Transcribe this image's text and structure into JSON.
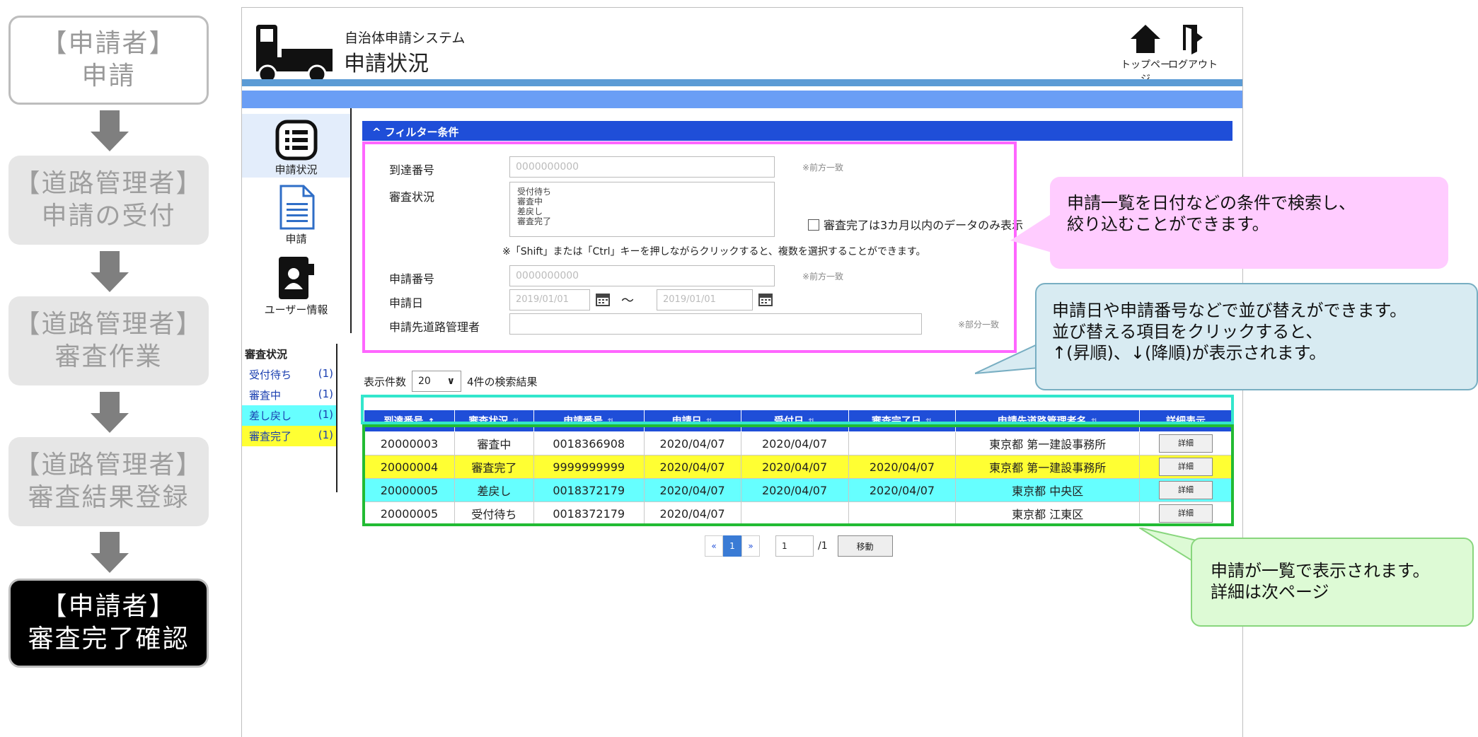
{
  "flow": {
    "step1_line1": "【申請者】",
    "step1_line2": "申請",
    "step2_line1": "【道路管理者】",
    "step2_line2": "申請の受付",
    "step3_line1": "【道路管理者】",
    "step3_line2": "審査作業",
    "step4_line1": "【道路管理者】",
    "step4_line2": "審査結果登録",
    "step5_line1": "【申請者】",
    "step5_line2": "審査完了確認"
  },
  "header": {
    "system_name": "自治体申請システム",
    "page_title": "申請状況",
    "top_page_label": "トップページ",
    "logout_label": "ログアウト"
  },
  "nav": {
    "status_label": "申請状況",
    "apply_label": "申請",
    "user_info_label": "ユーザー情報"
  },
  "status_panel": {
    "title": "審査状況",
    "items": [
      {
        "label": "受付待ち",
        "count": "(1)"
      },
      {
        "label": "審査中",
        "count": "(1)"
      },
      {
        "label": "差し戻し",
        "count": "(1)"
      },
      {
        "label": "審査完了",
        "count": "(1)"
      }
    ]
  },
  "filter": {
    "heading": "^ フィルター条件",
    "arrival_no_label": "到達番号",
    "arrival_no_placeholder": "0000000000",
    "prefix_note": "※前方一致",
    "review_status_label": "審査状況",
    "status_options": [
      "受付待ち",
      "審査中",
      "差戻し",
      "審査完了"
    ],
    "recent_only_label": "審査完了は3カ月以内のデータのみ表示",
    "multi_select_note": "※「Shift」または「Ctrl」キーを押しながらクリックすると、複数を選択することができます。",
    "application_no_label": "申請番号",
    "application_no_placeholder": "0000000000",
    "application_date_label": "申請日",
    "date_from": "2019/01/01",
    "date_to": "2019/01/01",
    "tilde": "～",
    "manager_label": "申請先道路管理者",
    "partial_note": "※部分一致"
  },
  "results": {
    "page_size_label": "表示件数",
    "page_size": "20",
    "count_text": "4件の検索結果",
    "columns": [
      "到達番号",
      "審査状況",
      "申請番号",
      "申請日",
      "受付日",
      "審査完了日",
      "申請先道路管理者名",
      "詳細表示"
    ],
    "sort_up": "↑",
    "sort_both": "⇅",
    "rows": [
      {
        "arrival": "20000003",
        "status": "審査中",
        "app_no": "0018366908",
        "app_date": "2020/04/07",
        "recv_date": "2020/04/07",
        "done_date": "",
        "manager": "東京都 第一建設事務所",
        "detail": "詳細"
      },
      {
        "arrival": "20000004",
        "status": "審査完了",
        "app_no": "9999999999",
        "app_date": "2020/04/07",
        "recv_date": "2020/04/07",
        "done_date": "2020/04/07",
        "manager": "東京都 第一建設事務所",
        "detail": "詳細"
      },
      {
        "arrival": "20000005",
        "status": "差戻し",
        "app_no": "0018372179",
        "app_date": "2020/04/07",
        "recv_date": "2020/04/07",
        "done_date": "2020/04/07",
        "manager": "東京都 中央区",
        "detail": "詳細"
      },
      {
        "arrival": "20000005",
        "status": "受付待ち",
        "app_no": "0018372179",
        "app_date": "2020/04/07",
        "recv_date": "",
        "done_date": "",
        "manager": "東京都 江東区",
        "detail": "詳細"
      }
    ]
  },
  "pager": {
    "prev": "«",
    "current": "1",
    "next": "»",
    "page_input": "1",
    "total": "/1",
    "go_label": "移動"
  },
  "callouts": {
    "filter_line1": "申請一覧を日付などの条件で検索し、",
    "filter_line2": "絞り込むことができます。",
    "sort_line1": "申請日や申請番号などで並び替えができます。",
    "sort_line2": "並び替える項目をクリックすると、",
    "sort_line3": "↑(昇順)、↓(降順)が表示されます。",
    "list_line1": "申請が一覧で表示されます。",
    "list_line2": "詳細は次ページ"
  },
  "colors": {
    "accent_blue": "#1f4ed8",
    "band_blue": "#6a9ef5",
    "highlight_yellow": "#ffff33",
    "highlight_cyan": "#66ffff",
    "frame_pink": "#ff66ff",
    "frame_green": "#22bb33",
    "frame_cyan": "#33e6cc"
  }
}
